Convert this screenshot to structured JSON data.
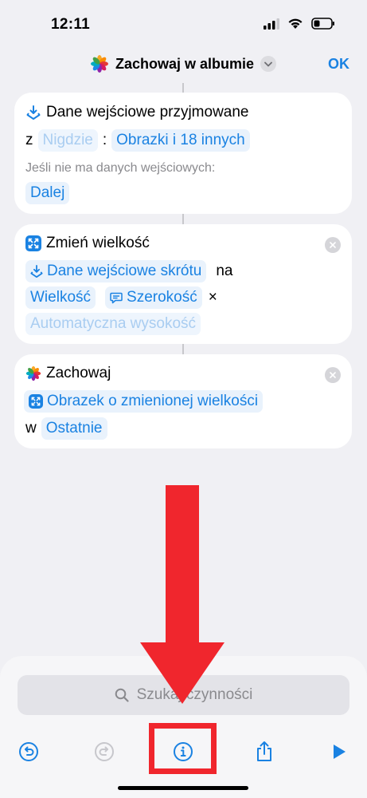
{
  "status_bar": {
    "time": "12:11"
  },
  "nav": {
    "title": "Zachowaj w albumie",
    "ok_label": "OK"
  },
  "card_input": {
    "title": "Dane wejściowe przyjmowane",
    "from_label": "z",
    "from_token": "Nigdzie",
    "colon": ":",
    "types_token": "Obrazki i 18 innych",
    "no_input_label": "Jeśli nie ma danych wejściowych:",
    "no_input_token": "Dalej"
  },
  "card_resize": {
    "title": "Zmień wielkość",
    "input_token": "Dane wejściowe skrótu",
    "na_label": "na",
    "size_token": "Wielkość",
    "width_token": "Szerokość",
    "times": "×",
    "height_token": "Automatyczna wysokość"
  },
  "card_save": {
    "title": "Zachowaj",
    "image_token": "Obrazek o zmienionej wielkości",
    "w_label": "w",
    "album_token": "Ostatnie"
  },
  "search": {
    "placeholder": "Szukaj czynności"
  },
  "icons": {
    "photos": "photos-app-icon",
    "input": "shortcut-input-icon",
    "resize": "resize-image-icon",
    "close": "close-icon",
    "undo": "undo-icon",
    "redo": "redo-icon",
    "info": "info-icon",
    "share": "share-icon",
    "play": "play-icon",
    "search": "search-icon"
  },
  "colors": {
    "accent": "#1a82e2",
    "annotation": "#f0262d"
  }
}
